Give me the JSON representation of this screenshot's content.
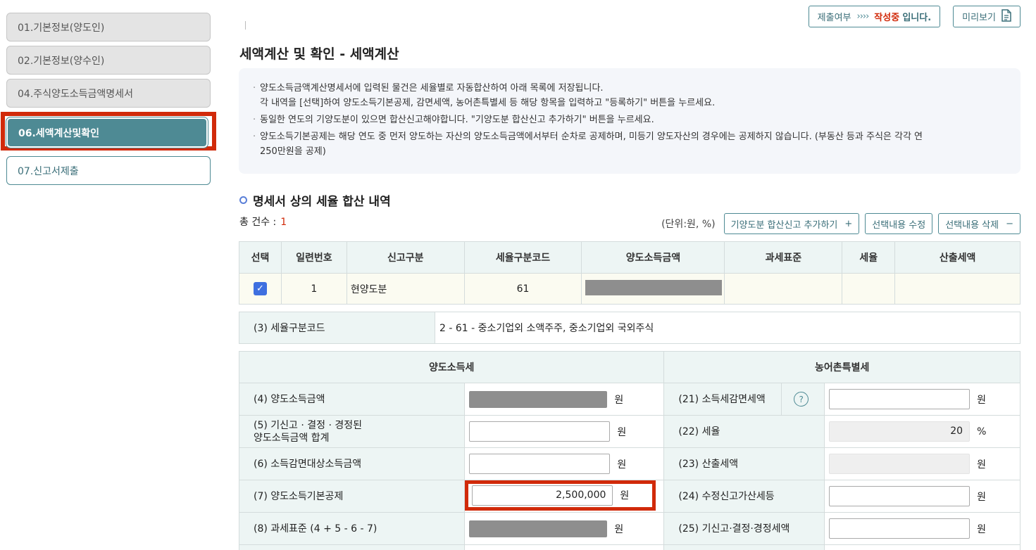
{
  "sidebar": {
    "items": [
      {
        "label": "01.기본정보(양도인)"
      },
      {
        "label": "02.기본정보(양수인)"
      },
      {
        "label": "04.주식양도소득금액명세서"
      },
      {
        "label": "06.세액계산및확인"
      },
      {
        "label": "07.신고서제출"
      }
    ]
  },
  "topbar": {
    "submit_label": "제출여부",
    "arrows": "››››",
    "status_word": "작성중",
    "status_suffix": "입니다.",
    "preview_label": "미리보기"
  },
  "page": {
    "title": "세액계산 및 확인 - 세액계산"
  },
  "notice": {
    "lines": [
      "양도소득금액계산명세서에 입력된 물건은 세율별로 자동합산하여 아래 목록에 저장됩니다.",
      "각 내역을 [선택]하여 양도소득기본공제, 감면세액, 농어촌특별세 등 해당 항목을 입력하고 \"등록하기\" 버튼을 누르세요.",
      "동일한 연도의 기양도분이 있으면 합산신고해야합니다. \"기양도분 합산신고 추가하기\" 버튼을 누르세요.",
      "양도소득기본공제는 해당 연도 중 먼저 양도하는 자산의 양도소득금액에서부터 순차로 공제하며, 미등기 양도자산의 경우에는 공제하지 않습니다. (부동산 등과 주식은 각각 연",
      "250만원을 공제)"
    ]
  },
  "section": {
    "title": "명세서 상의 세율 합산 내역",
    "count_label": "총 건수 :",
    "count_value": "1",
    "unit": "(단위:원, %)",
    "btn_add": "기양도분 합산신고 추가하기",
    "btn_edit": "선택내용 수정",
    "btn_delete": "선택내용 삭제",
    "plus": "+",
    "minus": "−"
  },
  "summary_table": {
    "headers": [
      "선택",
      "일련번호",
      "신고구분",
      "세율구분코드",
      "양도소득금액",
      "과세표준",
      "세율",
      "산출세액"
    ],
    "row": {
      "check": "✓",
      "seq": "1",
      "type": "현양도분",
      "code": "61"
    }
  },
  "rate_code": {
    "label": "(3) 세율구분코드",
    "value": "2  -  61  -  중소기업외 소액주주, 중소기업외 국외주식"
  },
  "detail": {
    "left_header": "양도소득세",
    "right_header": "농어촌특별세",
    "won": "원",
    "percent": "%",
    "help": "?",
    "left": [
      {
        "label": "(4) 양도소득금액",
        "value": ""
      },
      {
        "label1": "(5) 기신고 · 결정 · 경정된",
        "label2": "양도소득금액 합계",
        "value": ""
      },
      {
        "label": "(6) 소득감면대상소득금액",
        "value": ""
      },
      {
        "label": "(7) 양도소득기본공제",
        "value": "2,500,000"
      },
      {
        "label": "(8) 과세표준 (4 + 5 - 6 - 7)",
        "value": ""
      }
    ],
    "right": [
      {
        "label": "(21) 소득세감면세액",
        "value": ""
      },
      {
        "label": "(22) 세율",
        "value": "20"
      },
      {
        "label": "(23) 산출세액",
        "value": ""
      },
      {
        "label": "(24) 수정신고가산세등",
        "value": ""
      },
      {
        "label": "(25) 기신고·결정·경정세액",
        "value": ""
      }
    ]
  }
}
